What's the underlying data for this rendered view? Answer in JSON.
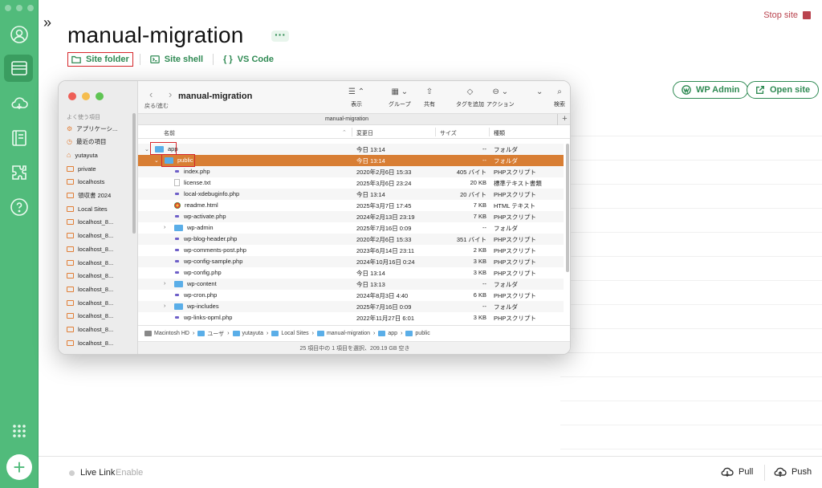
{
  "app": {
    "title": "manual-migration",
    "more_label": "···",
    "stop_site_label": "Stop site",
    "collapse_glyph": "»",
    "links": {
      "site_folder": "Site folder",
      "site_shell": "Site shell",
      "vs_code": "VS Code",
      "vs_code_glyph": "{ }"
    },
    "wp_admin_label": "WP Admin",
    "open_site_label": "Open site",
    "footer": {
      "live_link_label": "Live Link",
      "enable_label": "Enable",
      "pull_label": "Pull",
      "push_label": "Push"
    },
    "add_glyph": "+",
    "colors": {
      "brand_green": "#51bb7b",
      "link_green": "#2f8a53",
      "stop_red": "#b9434e",
      "highlight_red": "#d6262a"
    }
  },
  "finder": {
    "window_title": "manual-migration",
    "tab_label": "manual-migration",
    "nav_label": "戻る/進む",
    "nav_glyph": "‹ ›",
    "plus_glyph": "+",
    "toolbar": [
      {
        "glyph": "☰ ⌃",
        "label": "表示"
      },
      {
        "glyph": "▦ ⌄",
        "label": "グループ"
      },
      {
        "glyph": "⇧",
        "label": "共有"
      },
      {
        "glyph": "◇",
        "label": "タグを追加"
      },
      {
        "glyph": "⊖ ⌄",
        "label": "アクション"
      },
      {
        "glyph": "⌄",
        "label": ""
      },
      {
        "glyph": "⌕",
        "label": "検索"
      }
    ],
    "sidebar": {
      "heading": "よく使う項目",
      "items": [
        "アプリケーシ...",
        "最近の項目",
        "yutayuta",
        "private",
        "localhosts",
        "領収書 2024",
        "Local Sites",
        "localhost_8...",
        "localhost_8...",
        "localhost_8...",
        "localhost_8...",
        "localhost_8...",
        "localhost_8...",
        "localhost_8...",
        "localhost_8...",
        "localhost_8...",
        "localhost_8..."
      ]
    },
    "columns": {
      "name": "名前",
      "modified": "変更日",
      "size": "サイズ",
      "kind": "種類"
    },
    "rows": [
      {
        "name": "app",
        "date": "今日 13:14",
        "size": "--",
        "kind": "フォルダ",
        "type": "folder",
        "disc": "⌄"
      },
      {
        "name": "public",
        "date": "今日 13:14",
        "size": "--",
        "kind": "フォルダ",
        "type": "folder",
        "disc": "⌄",
        "selected": true
      },
      {
        "name": "index.php",
        "date": "2020年2月6日 15:33",
        "size": "405 バイト",
        "kind": "PHPスクリプト",
        "type": "php"
      },
      {
        "name": "license.txt",
        "date": "2025年3月6日 23:24",
        "size": "20 KB",
        "kind": "標準テキスト書類",
        "type": "txt"
      },
      {
        "name": "local-xdebuginfo.php",
        "date": "今日 13:14",
        "size": "20 バイト",
        "kind": "PHPスクリプト",
        "type": "php"
      },
      {
        "name": "readme.html",
        "date": "2025年3月7日 17:45",
        "size": "7 KB",
        "kind": "HTML テキスト",
        "type": "html"
      },
      {
        "name": "wp-activate.php",
        "date": "2024年2月13日 23:19",
        "size": "7 KB",
        "kind": "PHPスクリプト",
        "type": "php"
      },
      {
        "name": "wp-admin",
        "date": "2025年7月16日 0:09",
        "size": "--",
        "kind": "フォルダ",
        "type": "folder",
        "disc": "›"
      },
      {
        "name": "wp-blog-header.php",
        "date": "2020年2月6日 15:33",
        "size": "351 バイト",
        "kind": "PHPスクリプト",
        "type": "php"
      },
      {
        "name": "wp-comments-post.php",
        "date": "2023年6月14日 23:11",
        "size": "2 KB",
        "kind": "PHPスクリプト",
        "type": "php"
      },
      {
        "name": "wp-config-sample.php",
        "date": "2024年10月16日 0:24",
        "size": "3 KB",
        "kind": "PHPスクリプト",
        "type": "php"
      },
      {
        "name": "wp-config.php",
        "date": "今日 13:14",
        "size": "3 KB",
        "kind": "PHPスクリプト",
        "type": "php"
      },
      {
        "name": "wp-content",
        "date": "今日 13:13",
        "size": "--",
        "kind": "フォルダ",
        "type": "folder",
        "disc": "›"
      },
      {
        "name": "wp-cron.php",
        "date": "2024年8月3日 4:40",
        "size": "6 KB",
        "kind": "PHPスクリプト",
        "type": "php"
      },
      {
        "name": "wp-includes",
        "date": "2025年7月16日 0:09",
        "size": "--",
        "kind": "フォルダ",
        "type": "folder",
        "disc": "›"
      },
      {
        "name": "wp-links-opml.php",
        "date": "2022年11月27日 6:01",
        "size": "3 KB",
        "kind": "PHPスクリプト",
        "type": "php"
      }
    ],
    "path": [
      "Macintosh HD",
      "ユーザ",
      "yutayuta",
      "Local Sites",
      "manual-migration",
      "app",
      "public"
    ],
    "path_sep": "›",
    "status": "25 項目中の 1 項目を選択、209.19 GB 空き"
  }
}
